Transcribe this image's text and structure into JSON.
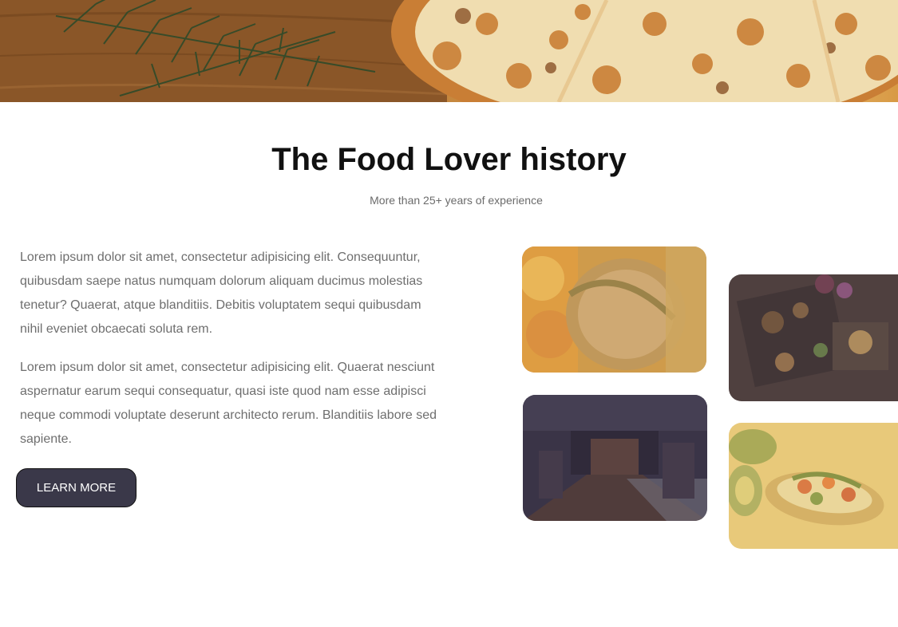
{
  "hero": {
    "image": "pizza-banner"
  },
  "section": {
    "title": "The Food Lover history",
    "subtitle": "More than 25+ years of experience",
    "paragraphs": [
      "Lorem ipsum dolor sit amet, consectetur adipisicing elit. Consequuntur, quibusdam saepe natus numquam dolorum aliquam ducimus molestias tenetur? Quaerat, atque blanditiis. Debitis voluptatem sequi quibusdam nihil eveniet obcaecati soluta rem.",
      "Lorem ipsum dolor sit amet, consectetur adipisicing elit. Quaerat nesciunt aspernatur earum sequi consequatur, quasi iste quod nam esse adipisci neque commodi voluptate deserunt architecto rerum. Blanditiis labore sed sapiente."
    ],
    "button_label": "LEARN MORE"
  },
  "gallery": [
    {
      "image": "roast-meat-photo"
    },
    {
      "image": "platter-photo"
    },
    {
      "image": "restaurant-interior-photo"
    },
    {
      "image": "avocado-toast-photo"
    }
  ],
  "colors": {
    "button_bg": "#3a3849",
    "text": "#6e6e6e",
    "title": "#111111"
  }
}
